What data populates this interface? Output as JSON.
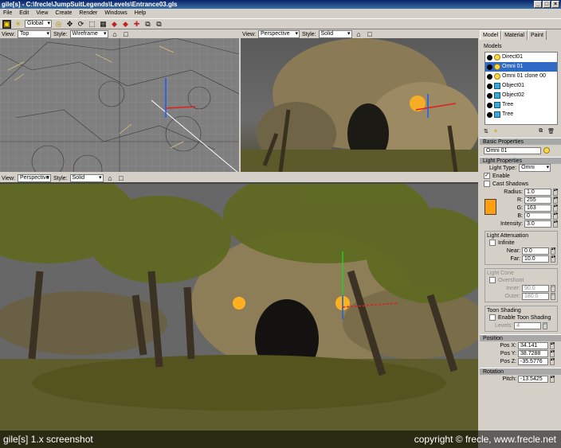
{
  "titlebar": {
    "title": "gile[s] - C:\\frecle\\JumpSuitLegends\\Levels\\Entrance03.gls",
    "min": "_",
    "max": "□",
    "close": "×"
  },
  "menu": [
    "File",
    "Edit",
    "View",
    "Create",
    "Render",
    "Windows",
    "Help"
  ],
  "toolbar": {
    "coord_system": "Global"
  },
  "viewports": {
    "top": {
      "view_label": "View:",
      "view": "Top",
      "style_label": "Style:",
      "style": "Wireframe"
    },
    "persp1": {
      "view_label": "View:",
      "view": "Perspective",
      "style_label": "Style:",
      "style": "Solid"
    },
    "persp2": {
      "view_label": "View:",
      "view": "Perspective",
      "style_label": "Style:",
      "style": "Solid"
    }
  },
  "panel": {
    "tabs": [
      "Model",
      "Material",
      "Paint"
    ],
    "models_label": "Models",
    "models": [
      {
        "name": "Direct01",
        "icon": "bulb"
      },
      {
        "name": "Omni 01",
        "icon": "bulb",
        "selected": true
      },
      {
        "name": "Omni 01 clone 00",
        "icon": "bulb"
      },
      {
        "name": "Object01",
        "icon": "cube"
      },
      {
        "name": "Object02",
        "icon": "cube"
      },
      {
        "name": "Tree",
        "icon": "cube"
      },
      {
        "name": "Tree",
        "icon": "cube"
      }
    ],
    "basic": {
      "header": "Basic Properties",
      "name": "Omni 01"
    },
    "light": {
      "header": "Light Properties",
      "type_label": "Light Type:",
      "type": "Omni",
      "enable": "Enable",
      "cast_shadows": "Cast Shadows",
      "radius_label": "Radius:",
      "radius": "1.0",
      "r_label": "R:",
      "r": "255",
      "g_label": "G:",
      "g": "163",
      "b_label": "B:",
      "b": "0",
      "intensity_label": "Intensity:",
      "intensity": "3.0",
      "swatch": "#ff9f10"
    },
    "attenuation": {
      "header": "Light Attenuation",
      "infinite": "Infinite",
      "near_label": "Near:",
      "near": "0.0",
      "far_label": "Far:",
      "far": "10.0"
    },
    "cone": {
      "header": "Light Cone",
      "overshoot": "Overshoot",
      "inner_label": "Inner:",
      "inner": "90.0",
      "outer_label": "Outer:",
      "outer": "180.0"
    },
    "toon": {
      "header": "Toon Shading",
      "enable": "Enable Toon Shading",
      "levels_label": "Levels:",
      "levels": "4"
    },
    "position": {
      "header": "Position",
      "x_label": "Pos X:",
      "x": "34.141",
      "y_label": "Pos Y:",
      "y": "38.7288",
      "z_label": "Pos Z:",
      "z": "-35.5776"
    },
    "rotation": {
      "header": "Rotation",
      "pitch_label": "Pitch:",
      "pitch": "-13.5425"
    }
  },
  "footer": {
    "left": "gile[s] 1.x screenshot",
    "right": "copyright © frecle, www.frecle.net"
  }
}
